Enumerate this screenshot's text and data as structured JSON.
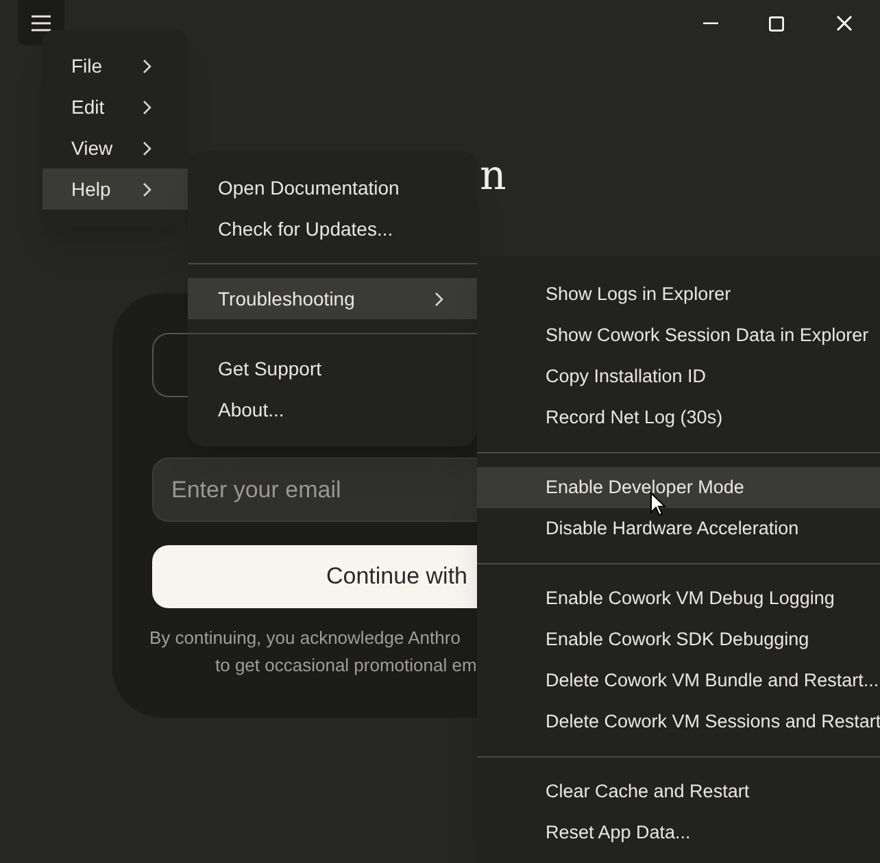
{
  "menu_bar": {
    "items": [
      {
        "label": "File",
        "kind": "submenu",
        "selected": false
      },
      {
        "label": "Edit",
        "kind": "submenu",
        "selected": false
      },
      {
        "label": "View",
        "kind": "submenu",
        "selected": false
      },
      {
        "label": "Help",
        "kind": "submenu",
        "selected": true
      }
    ]
  },
  "help_menu": {
    "groups": [
      [
        {
          "label": "Open Documentation",
          "kind": "action",
          "selected": false
        },
        {
          "label": "Check for Updates...",
          "kind": "action",
          "selected": false
        }
      ],
      [
        {
          "label": "Troubleshooting",
          "kind": "submenu",
          "selected": true
        }
      ],
      [
        {
          "label": "Get Support",
          "kind": "action",
          "selected": false
        },
        {
          "label": "About...",
          "kind": "action",
          "selected": false
        }
      ]
    ]
  },
  "troubleshooting_menu": {
    "groups": [
      [
        {
          "label": "Show Logs in Explorer",
          "selected": false
        },
        {
          "label": "Show Cowork Session Data in Explorer",
          "selected": false
        },
        {
          "label": "Copy Installation ID",
          "selected": false
        },
        {
          "label": "Record Net Log (30s)",
          "selected": false
        }
      ],
      [
        {
          "label": "Enable Developer Mode",
          "selected": true
        },
        {
          "label": "Disable Hardware Acceleration",
          "selected": false
        }
      ],
      [
        {
          "label": "Enable Cowork VM Debug Logging",
          "selected": false
        },
        {
          "label": "Enable Cowork SDK Debugging",
          "selected": false
        },
        {
          "label": "Delete Cowork VM Bundle and Restart...",
          "selected": false
        },
        {
          "label": "Delete Cowork VM Sessions and Restart",
          "selected": false
        }
      ],
      [
        {
          "label": "Clear Cache and Restart",
          "selected": false
        },
        {
          "label": "Reset App Data...",
          "selected": false
        }
      ]
    ]
  },
  "page": {
    "heading": "n",
    "email": {
      "placeholder": "Enter your email"
    },
    "continue_button": "Continue with",
    "disclaimer": [
      "By continuing, you acknowledge Anthro",
      "to get occasional promotional em"
    ]
  }
}
